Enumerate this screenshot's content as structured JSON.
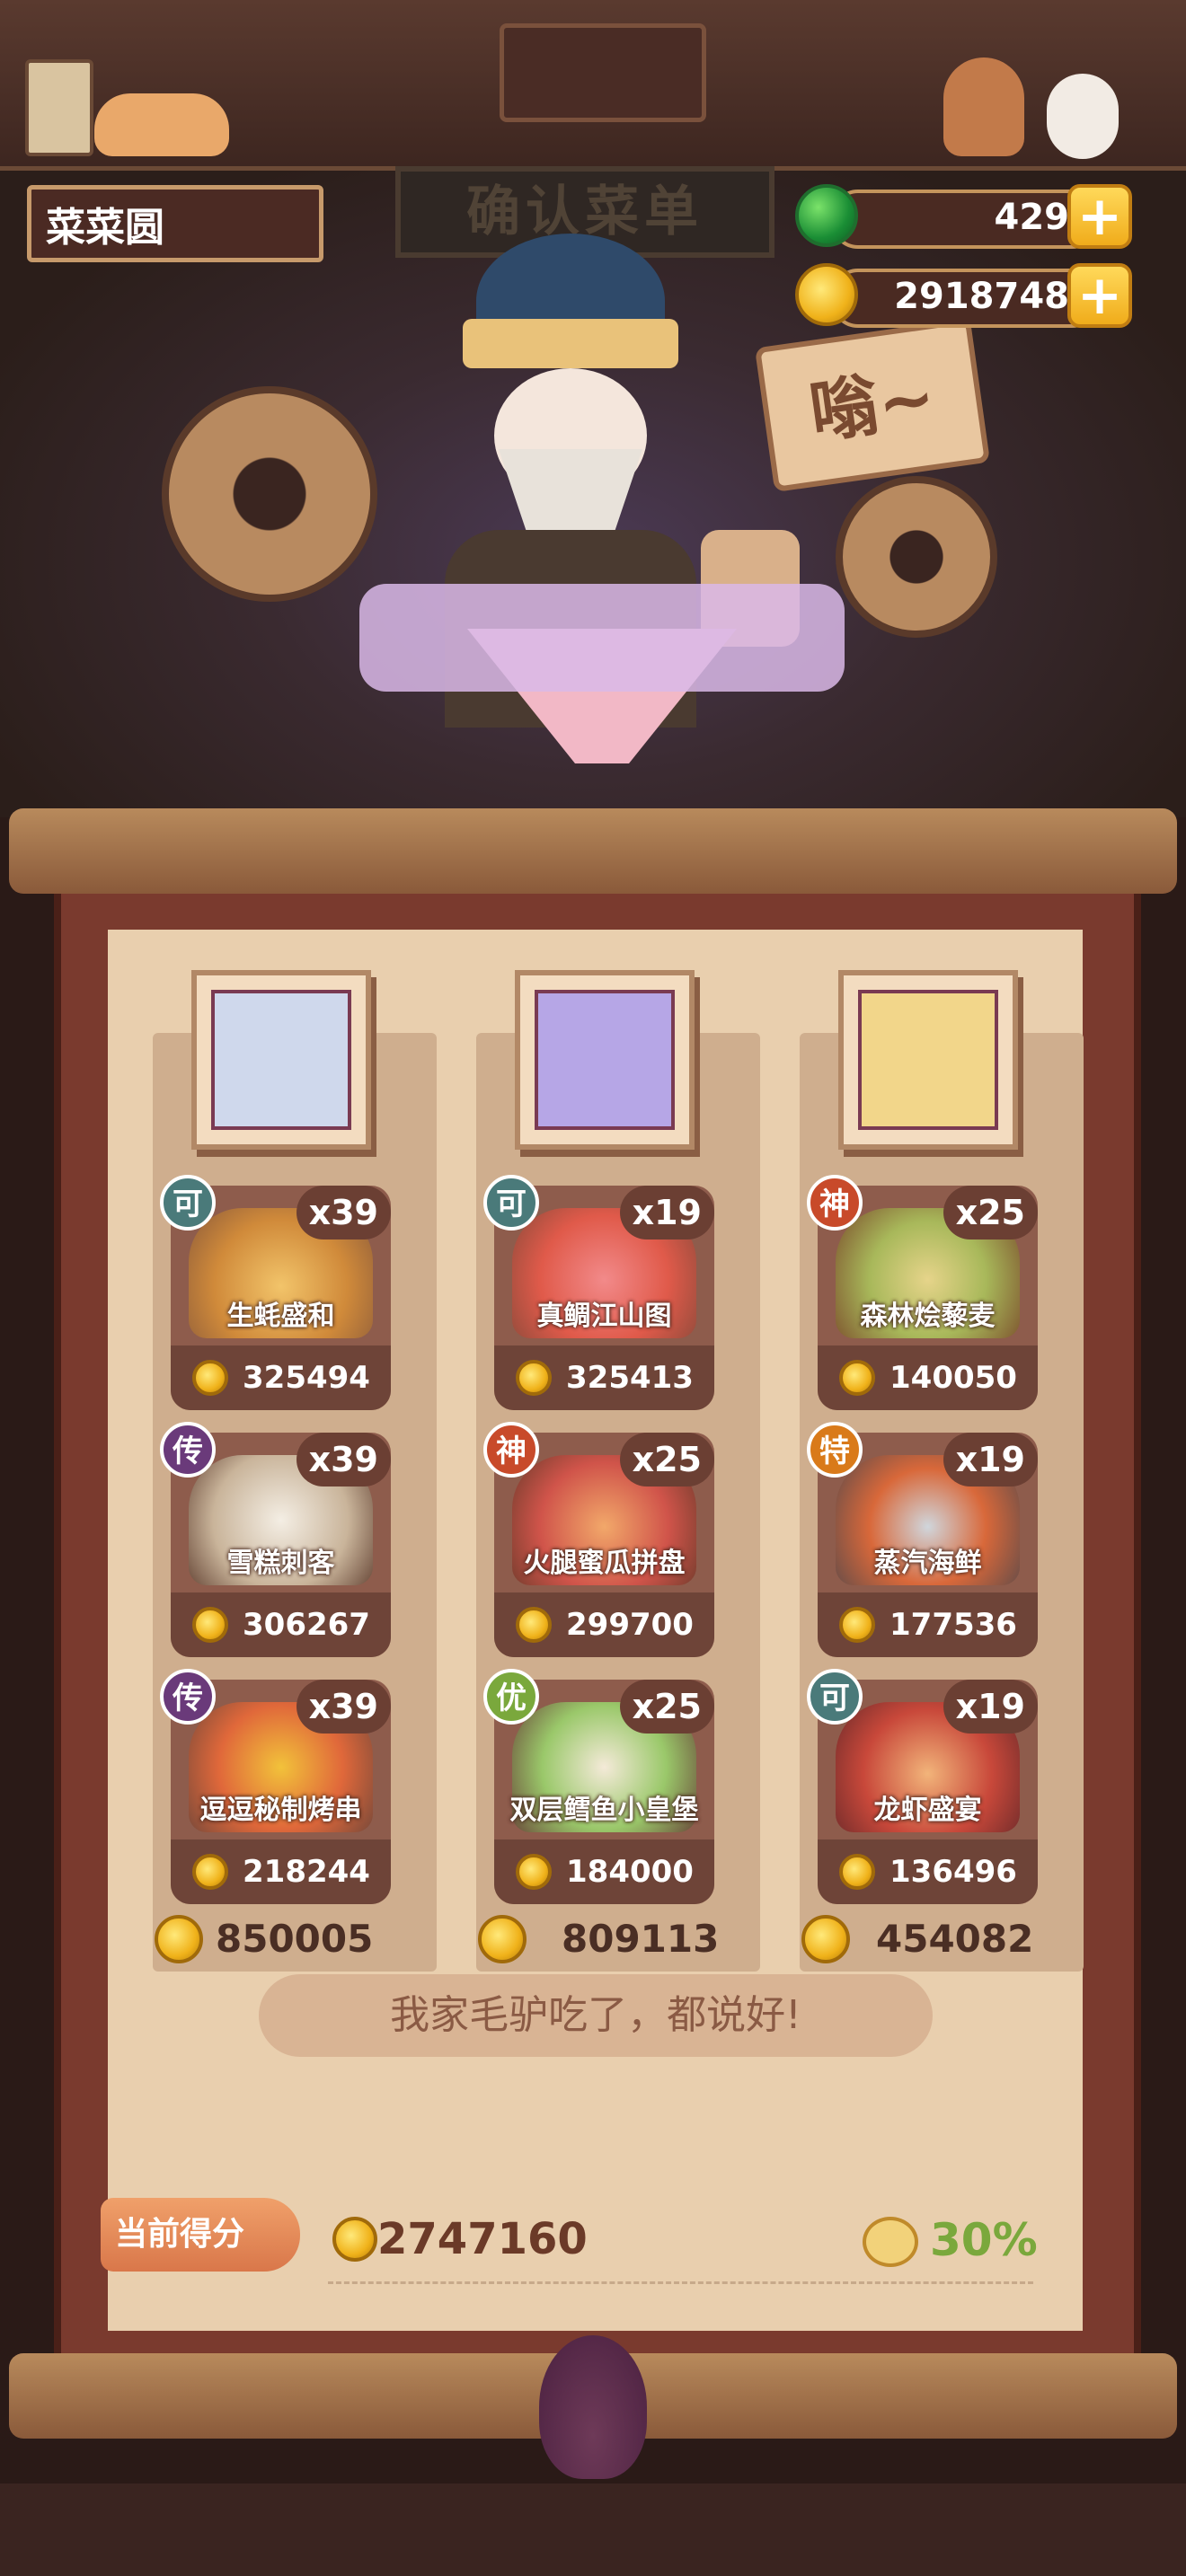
{
  "header": {
    "restaurant_name": "菜菜圆",
    "jade_value": "429",
    "coin_value": "2918748",
    "sign_text": "确认菜单",
    "hum_text": "嗡~"
  },
  "colors": {
    "jade": "#1a8e35",
    "coin": "#f0b21a",
    "paper": "#e9cfae",
    "frame": "#7a3a2e"
  },
  "columns": [
    {
      "total": "850005",
      "dishes": [
        {
          "badge": "可",
          "badge_color": "#4a7a7a",
          "count": "x39",
          "name": "生蚝盛和",
          "price": "325494"
        },
        {
          "badge": "传",
          "badge_color": "#6a3a7a",
          "count": "x39",
          "name": "雪糕刺客",
          "price": "306267"
        },
        {
          "badge": "传",
          "badge_color": "#6a3a7a",
          "count": "x39",
          "name": "逗逗秘制烤串",
          "price": "218244"
        }
      ]
    },
    {
      "total": "809113",
      "dishes": [
        {
          "badge": "可",
          "badge_color": "#4a7a7a",
          "count": "x19",
          "name": "真鲷江山图",
          "price": "325413"
        },
        {
          "badge": "神",
          "badge_color": "#c84a2a",
          "count": "x25",
          "name": "火腿蜜瓜拼盘",
          "price": "299700"
        },
        {
          "badge": "优",
          "badge_color": "#7aa83c",
          "count": "x25",
          "name": "双层鳕鱼小皇堡",
          "price": "184000"
        }
      ]
    },
    {
      "total": "454082",
      "dishes": [
        {
          "badge": "神",
          "badge_color": "#c84a2a",
          "count": "x25",
          "name": "森林烩藜麦",
          "price": "140050"
        },
        {
          "badge": "特",
          "badge_color": "#d97a1a",
          "count": "x19",
          "name": "蒸汽海鲜",
          "price": "177536"
        },
        {
          "badge": "可",
          "badge_color": "#4a7a7a",
          "count": "x19",
          "name": "龙虾盛宴",
          "price": "136496"
        }
      ]
    }
  ],
  "slogan": "我家毛驴吃了，都说好!",
  "score": {
    "label": "当前得分",
    "value": "2747160",
    "percent": "30%"
  }
}
